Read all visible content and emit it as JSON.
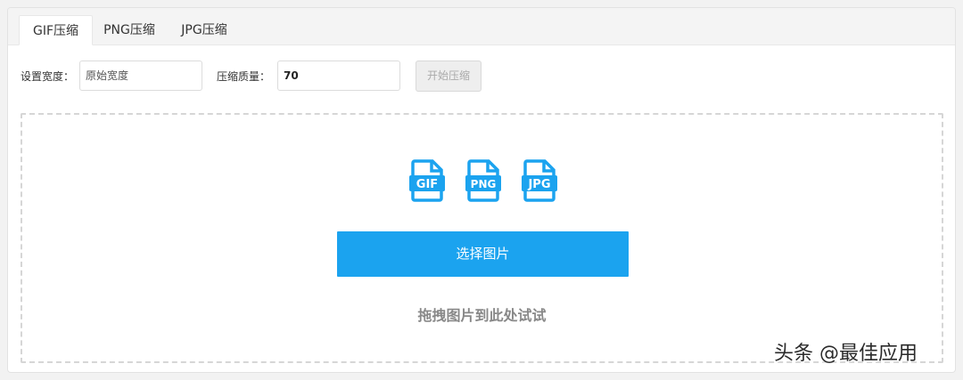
{
  "tabs": [
    {
      "label": "GIF压缩",
      "active": true
    },
    {
      "label": "PNG压缩",
      "active": false
    },
    {
      "label": "JPG压缩",
      "active": false
    }
  ],
  "toolbar": {
    "width_label": "设置宽度：",
    "width_placeholder": "原始宽度",
    "quality_label": "压缩质量：",
    "quality_value": "70",
    "start_button": "开始压缩"
  },
  "dropzone": {
    "icons": [
      {
        "name": "gif-file-icon",
        "text": "GIF"
      },
      {
        "name": "png-file-icon",
        "text": "PNG"
      },
      {
        "name": "jpg-file-icon",
        "text": "JPG"
      }
    ],
    "select_button": "选择图片",
    "hint": "拖拽图片到此处试试"
  },
  "watermark": "头条 @最佳应用",
  "colors": {
    "accent": "#1ba3ef",
    "hint_text": "#888888",
    "dashed_border": "#d6d6d6"
  }
}
